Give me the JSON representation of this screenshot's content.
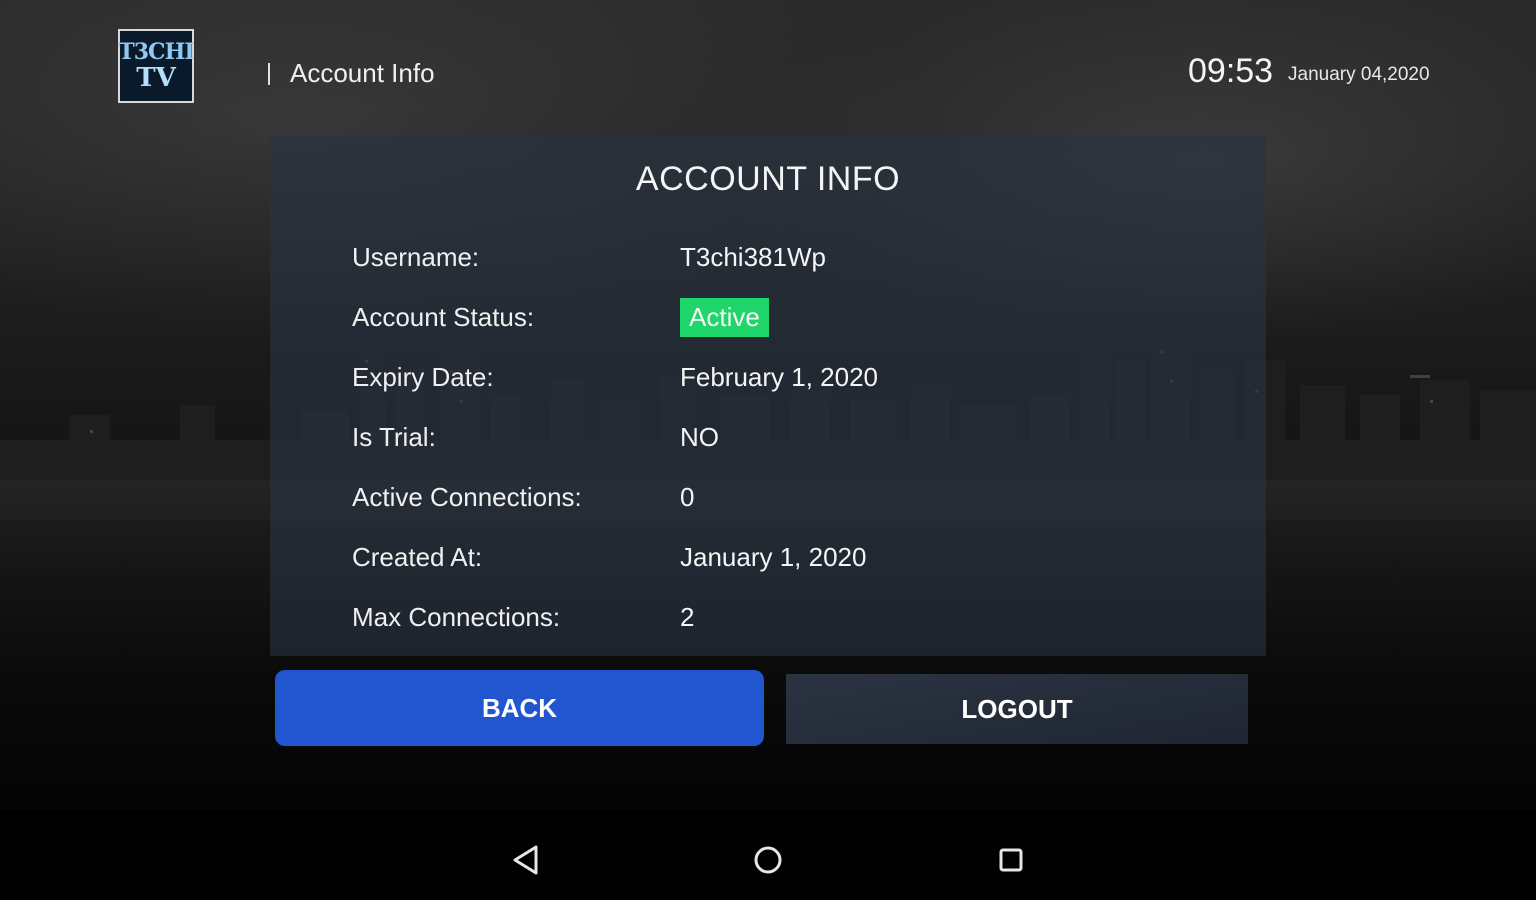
{
  "header": {
    "logo_line1": "T3CHI",
    "logo_line2": "TV",
    "breadcrumb": "Account Info",
    "time": "09:53",
    "date": "January 04,2020"
  },
  "panel": {
    "title": "ACCOUNT INFO",
    "rows": [
      {
        "label": "Username:",
        "value": "T3chi381Wp"
      },
      {
        "label": "Account Status:",
        "value": "Active"
      },
      {
        "label": "Expiry Date:",
        "value": "February 1, 2020"
      },
      {
        "label": "Is Trial:",
        "value": "NO"
      },
      {
        "label": "Active Connections:",
        "value": "0"
      },
      {
        "label": "Created At:",
        "value": "January 1, 2020"
      },
      {
        "label": "Max Connections:",
        "value": "2"
      }
    ],
    "status_color": "#1fd66a"
  },
  "buttons": {
    "back": "BACK",
    "logout": "LOGOUT",
    "back_color": "#2256d1"
  },
  "navbar": {
    "icons": [
      "back-triangle-icon",
      "home-circle-icon",
      "recents-square-icon"
    ]
  }
}
